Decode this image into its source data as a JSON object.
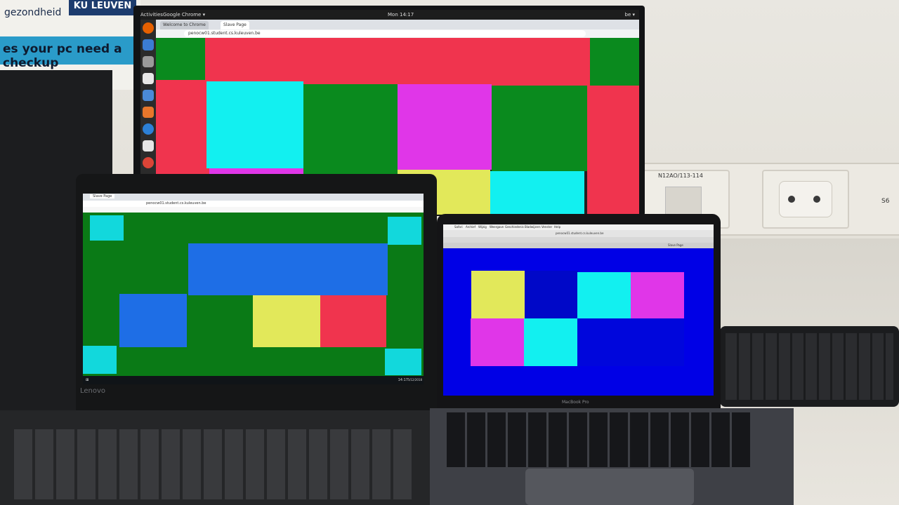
{
  "scene": {
    "poster": {
      "text": "gezondheid",
      "ku_label": "KU LEUVEN",
      "headline": "es your pc need a checkup"
    },
    "outlet_label": "N12AO/113-114",
    "outlet_label_right": "S6"
  },
  "monitor": {
    "topbar": {
      "activities": "Activities",
      "app": "Google Chrome ▾",
      "clock": "Mon 14:17",
      "tray": "be ▾"
    },
    "tabs": [
      "Welcome to Chrome",
      "Slave Page"
    ],
    "url": "penocw01.student.cs.kuleuven.be"
  },
  "lenovo": {
    "tab": "Slave Page",
    "url": "penocw01.student.cs.kuleuven.be",
    "brand": "Lenovo",
    "clock": "14:17",
    "date": "5/12/2018"
  },
  "macbook": {
    "menu": [
      "Safari",
      "Archief",
      "Wijzig",
      "Weergave",
      "Geschiedenis",
      "Bladwijzers",
      "Venster",
      "Help"
    ],
    "url": "penocw01.student.cs.kuleuven.be",
    "tab": "Slave Page",
    "label": "MacBook Pro"
  },
  "colors": {
    "red": "#f0344e",
    "green": "#0a8a1e",
    "cyan": "#12f0f0",
    "magenta": "#e036e8",
    "yellow": "#e2e85a",
    "blue": "#1e6ee6",
    "deep_blue": "#0000e6"
  }
}
